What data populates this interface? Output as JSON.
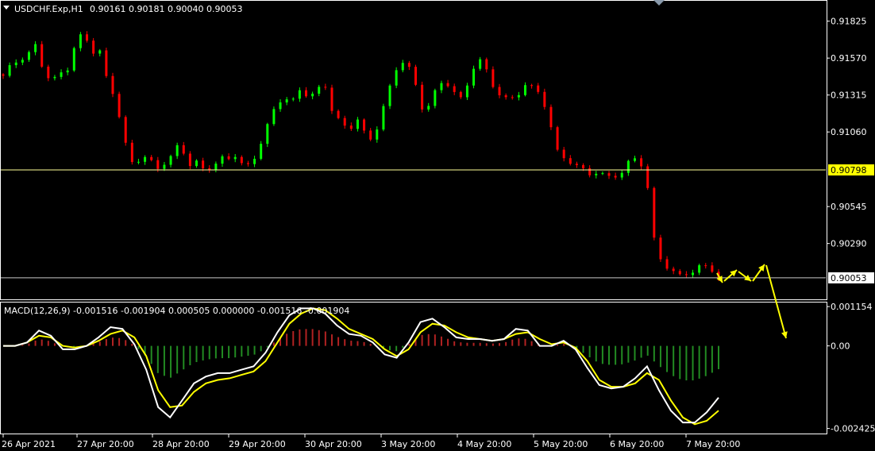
{
  "main_header": {
    "symbol": "USDCHF.Exp,H1",
    "ohlc": "0.90161 0.90181 0.90040 0.90053"
  },
  "macd_header": {
    "text": "MACD(12,26,9) -0.001516 -0.001904 0.000505 0.000000 -0.001516 -0.001904"
  },
  "colors": {
    "background": "#000000",
    "bull": "#00ff00",
    "bear": "#ff0000",
    "hist_pos": "#b22222",
    "hist_neg": "#228b22",
    "macd_line": "#ffffff",
    "signal_line": "#ffff00",
    "level_line": "#ffff99",
    "arrow": "#ffff00"
  },
  "chart_data": [
    {
      "type": "candlestick",
      "title": "USDCHF.Exp,H1",
      "ylim": [
        0.8991,
        0.9196
      ],
      "y_ticks": [
        "0.91825",
        "0.91570",
        "0.91315",
        "0.91060",
        "0.90798",
        "0.90545",
        "0.90290",
        "0.90053"
      ],
      "x_ticks": [
        "26 Apr 2021",
        "27 Apr 20:00",
        "28 Apr 20:00",
        "29 Apr 20:00",
        "30 Apr 20:00",
        "3 May 20:00",
        "4 May 20:00",
        "5 May 20:00",
        "6 May 20:00",
        "7 May 20:00"
      ],
      "series": [
        {
          "name": "USDCHF.Exp",
          "close_path": [
            [
              "26 Apr 2021",
              0.9144
            ],
            [
              0.9152
            ],
            [
              0.9156
            ],
            [
              0.916
            ],
            [
              0.9166
            ],
            [
              0.9148
            ],
            [
              0.914
            ],
            [
              0.9146
            ],
            [
              0.915
            ],
            [
              0.9168
            ],
            [
              "27 Apr 20:00",
              0.9175
            ],
            [
              0.916
            ],
            [
              0.9162
            ],
            [
              0.914
            ],
            [
              0.913
            ],
            [
              0.9102
            ],
            [
              0.9084
            ],
            [
              0.9086
            ],
            [
              0.909
            ],
            [
              0.908
            ],
            [
              "28 Apr 20:00",
              0.9085
            ],
            [
              0.909
            ],
            [
              0.9098
            ],
            [
              0.9082
            ],
            [
              0.9086
            ],
            [
              0.908
            ],
            [
              0.9082
            ],
            [
              0.9088
            ],
            [
              0.9086
            ],
            [
              0.909
            ],
            [
              "29 Apr 20:00",
              0.9082
            ],
            [
              0.9085
            ],
            [
              0.9098
            ],
            [
              0.9112
            ],
            [
              0.9124
            ],
            [
              0.913
            ],
            [
              0.9128
            ],
            [
              0.9136
            ],
            [
              0.913
            ],
            [
              0.9134
            ],
            [
              "30 Apr 20:00",
              0.9138
            ],
            [
              0.912
            ],
            [
              0.9114
            ],
            [
              0.9106
            ],
            [
              0.9116
            ],
            [
              0.9104
            ],
            [
              0.9098
            ],
            [
              0.912
            ],
            [
              0.9136
            ],
            [
              0.915
            ],
            [
              "3 May 20:00",
              0.9156
            ],
            [
              0.9144
            ],
            [
              0.9122
            ],
            [
              0.9126
            ],
            [
              0.9138
            ],
            [
              0.914
            ],
            [
              0.9134
            ],
            [
              0.9128
            ],
            [
              0.9142
            ],
            [
              0.916
            ],
            [
              "4 May 20:00",
              0.915
            ],
            [
              0.9136
            ],
            [
              0.913
            ],
            [
              0.9128
            ],
            [
              0.9132
            ],
            [
              0.914
            ],
            [
              0.9136
            ],
            [
              0.913
            ],
            [
              0.9112
            ],
            [
              0.9092
            ],
            [
              "5 May 20:00",
              0.9088
            ],
            [
              0.9084
            ],
            [
              0.908
            ],
            [
              0.9076
            ],
            [
              0.9078
            ],
            [
              0.9076
            ],
            [
              0.9076
            ],
            [
              0.9078
            ],
            [
              0.9086
            ],
            [
              0.9088
            ],
            [
              "6 May 20:00",
              0.9075
            ],
            [
              0.9032
            ],
            [
              0.9016
            ],
            [
              0.901
            ],
            [
              0.9006
            ],
            [
              0.9008
            ],
            [
              0.901
            ],
            [
              0.9016
            ],
            [
              0.9012
            ],
            [
              0.90053
            ]
          ]
        }
      ],
      "horizontal_levels": [
        0.90798,
        0.90053
      ],
      "price_labels": {
        "level": "0.90798",
        "last": "0.90053"
      },
      "annotations": [
        "zigzag forecast arrows"
      ]
    },
    {
      "type": "macd",
      "title": "MACD(12,26,9)",
      "ylim": [
        -0.00255,
        0.00125
      ],
      "y_ticks": [
        "0.001154",
        "0.00",
        "-0.002425"
      ],
      "series": [
        {
          "name": "MACD",
          "values": [
            0.0,
            0.0,
            0.0001,
            0.00045,
            0.0003,
            -0.0001,
            -0.0001,
            0.0,
            0.00025,
            0.00055,
            0.0005,
            5e-05,
            -0.0007,
            -0.0018,
            -0.0021,
            -0.0016,
            -0.0011,
            -0.0009,
            -0.0008,
            -0.0008,
            -0.0007,
            -0.0006,
            -0.0002,
            0.0004,
            0.0009,
            0.0011,
            0.0011,
            0.00095,
            0.0006,
            0.00035,
            0.0003,
            0.0001,
            -0.00025,
            -0.00035,
            0.0001,
            0.0007,
            0.0008,
            0.00055,
            0.00025,
            0.0002,
            0.0002,
            0.00015,
            0.0002,
            0.0005,
            0.00045,
            0.0,
            0.0,
            0.00015,
            -0.0001,
            -0.00065,
            -0.00115,
            -0.00125,
            -0.0012,
            -0.00095,
            -0.0006,
            -0.0013,
            -0.0019,
            -0.00225,
            -0.00225,
            -0.00195,
            -0.00152
          ]
        },
        {
          "name": "Signal",
          "values": [
            0.0,
            0.0,
            0.0001,
            0.0003,
            0.00025,
            0.0,
            -5e-05,
            0.0,
            0.00015,
            0.00035,
            0.00045,
            0.00025,
            -0.0003,
            -0.0013,
            -0.0018,
            -0.00175,
            -0.00135,
            -0.0011,
            -0.001,
            -0.00095,
            -0.00085,
            -0.00075,
            -0.00045,
            0.0001,
            0.00065,
            0.00095,
            0.0011,
            0.00105,
            0.0008,
            0.0005,
            0.00035,
            0.0002,
            -0.0001,
            -0.0003,
            -0.0001,
            0.0004,
            0.00065,
            0.0006,
            0.0004,
            0.00025,
            0.0002,
            0.00015,
            0.0002,
            0.00035,
            0.0004,
            0.0002,
            5e-05,
            0.0001,
            -5e-05,
            -0.00045,
            -0.001,
            -0.0012,
            -0.0012,
            -0.0011,
            -0.0008,
            -0.001,
            -0.0016,
            -0.0021,
            -0.0023,
            -0.0022,
            -0.0019
          ]
        }
      ]
    }
  ]
}
